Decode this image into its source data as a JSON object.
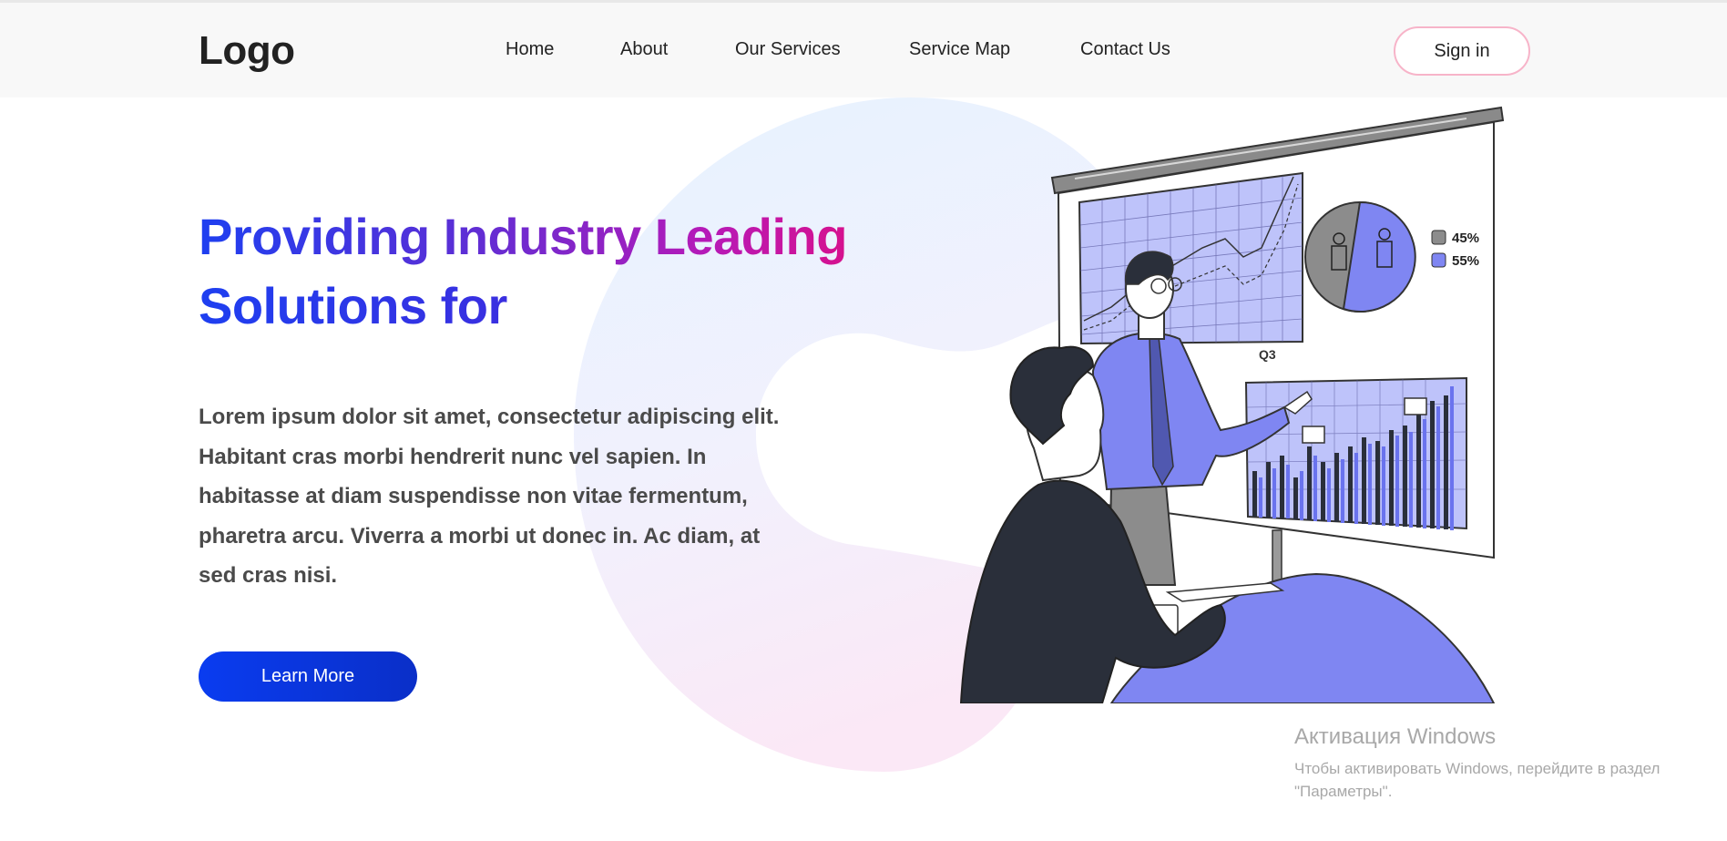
{
  "header": {
    "logo": "Logo",
    "nav": [
      {
        "label": "Home"
      },
      {
        "label": "About"
      },
      {
        "label": "Our Services"
      },
      {
        "label": "Service Map"
      },
      {
        "label": "Contact Us"
      }
    ],
    "signin_label": "Sign in"
  },
  "hero": {
    "title_line1": "Providing Industry Leading",
    "title_line2": "Solutions for",
    "body": "Lorem ipsum dolor sit amet, consectetur adipiscing elit. Habitant cras morbi hendrerit nunc vel sapien. In habitasse at diam suspendisse non vitae fermentum, pharetra arcu. Viverra a morbi ut donec in. Ac diam, at sed cras nisi.",
    "cta_label": "Learn More"
  },
  "illustration": {
    "pie_labels": [
      "45%",
      "55%"
    ],
    "chart_label": "Q3"
  },
  "watermark": {
    "title": "Активация Windows",
    "subtitle_line1": "Чтобы активировать Windows, перейдите в раздел",
    "subtitle_line2": "\"Параметры\"."
  },
  "colors": {
    "accent": "#0a3cf0",
    "gradient_end": "#d6118e",
    "illustration_purple": "#7f86f2",
    "signin_border": "#f7b4c9"
  }
}
